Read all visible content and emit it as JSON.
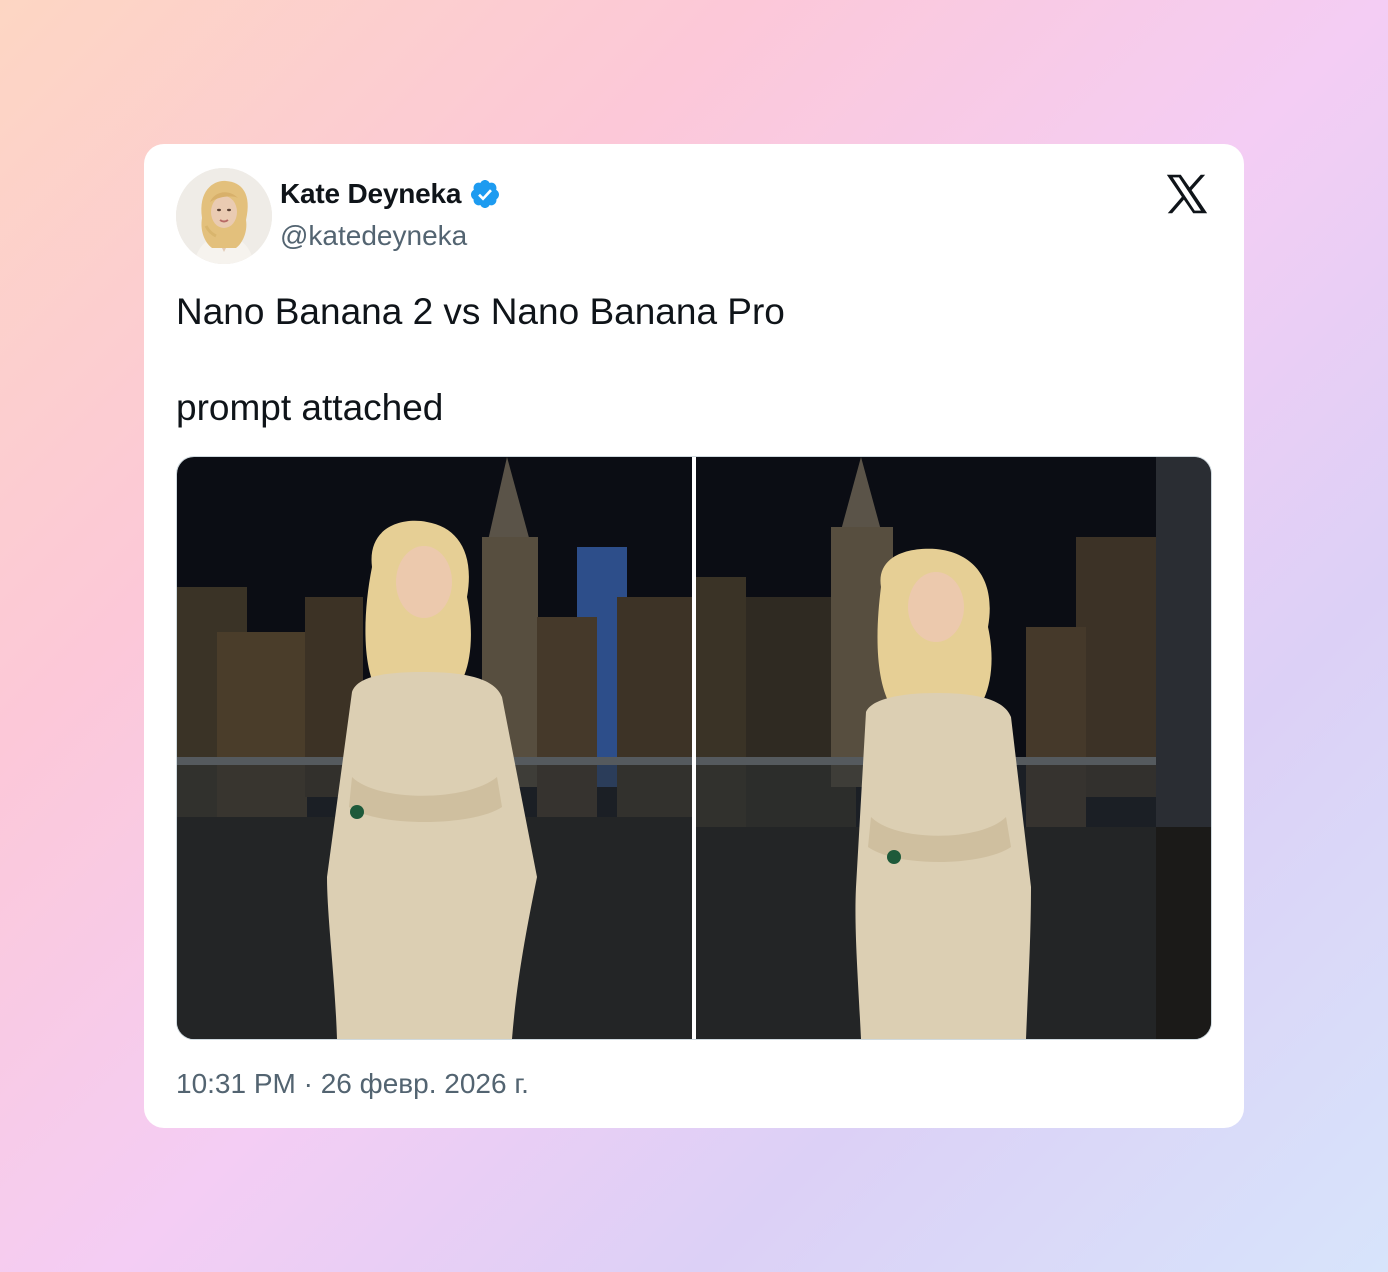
{
  "tweet": {
    "author": {
      "name": "Kate Deyneka",
      "handle": "@katedeyneka",
      "verified": true,
      "verified_color": "#1d9bf0"
    },
    "text_lines": [
      "Nano Banana 2 vs Nano Banana Pro",
      "prompt attached"
    ],
    "timestamp": "10:31 PM · 26 февр. 2026 г.",
    "images": [
      "night-city-rooftop-portrait",
      "night-city-rooftop-portrait"
    ]
  },
  "icons": {
    "platform": "x-logo-icon",
    "verified": "verified-badge-icon"
  },
  "colors": {
    "text_primary": "#0f1419",
    "text_secondary": "#536471",
    "card": "#ffffff",
    "accent": "#1d9bf0"
  }
}
